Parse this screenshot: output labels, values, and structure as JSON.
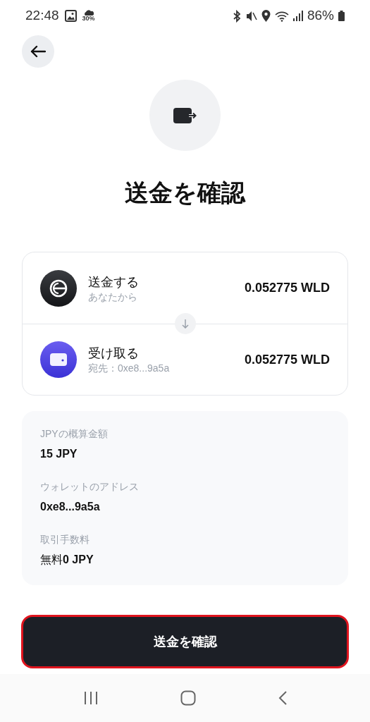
{
  "status_bar": {
    "time": "22:48",
    "weather": "30%",
    "battery": "86%"
  },
  "title": "送金を確認",
  "transfer": [
    {
      "kind": "send",
      "label": "送金する",
      "sub": "あなたから",
      "amount": "0.052775 WLD"
    },
    {
      "kind": "receive",
      "label": "受け取る",
      "sub": "宛先：0xe8...9a5a",
      "amount": "0.052775 WLD"
    }
  ],
  "details": [
    {
      "label": "JPYの概算金額",
      "value": "15 JPY"
    },
    {
      "label": "ウォレットのアドレス",
      "value": "0xe8...9a5a"
    },
    {
      "label": "取引手数料",
      "value": "無料**0 JPY**"
    }
  ],
  "confirm_button": "送金を確認"
}
